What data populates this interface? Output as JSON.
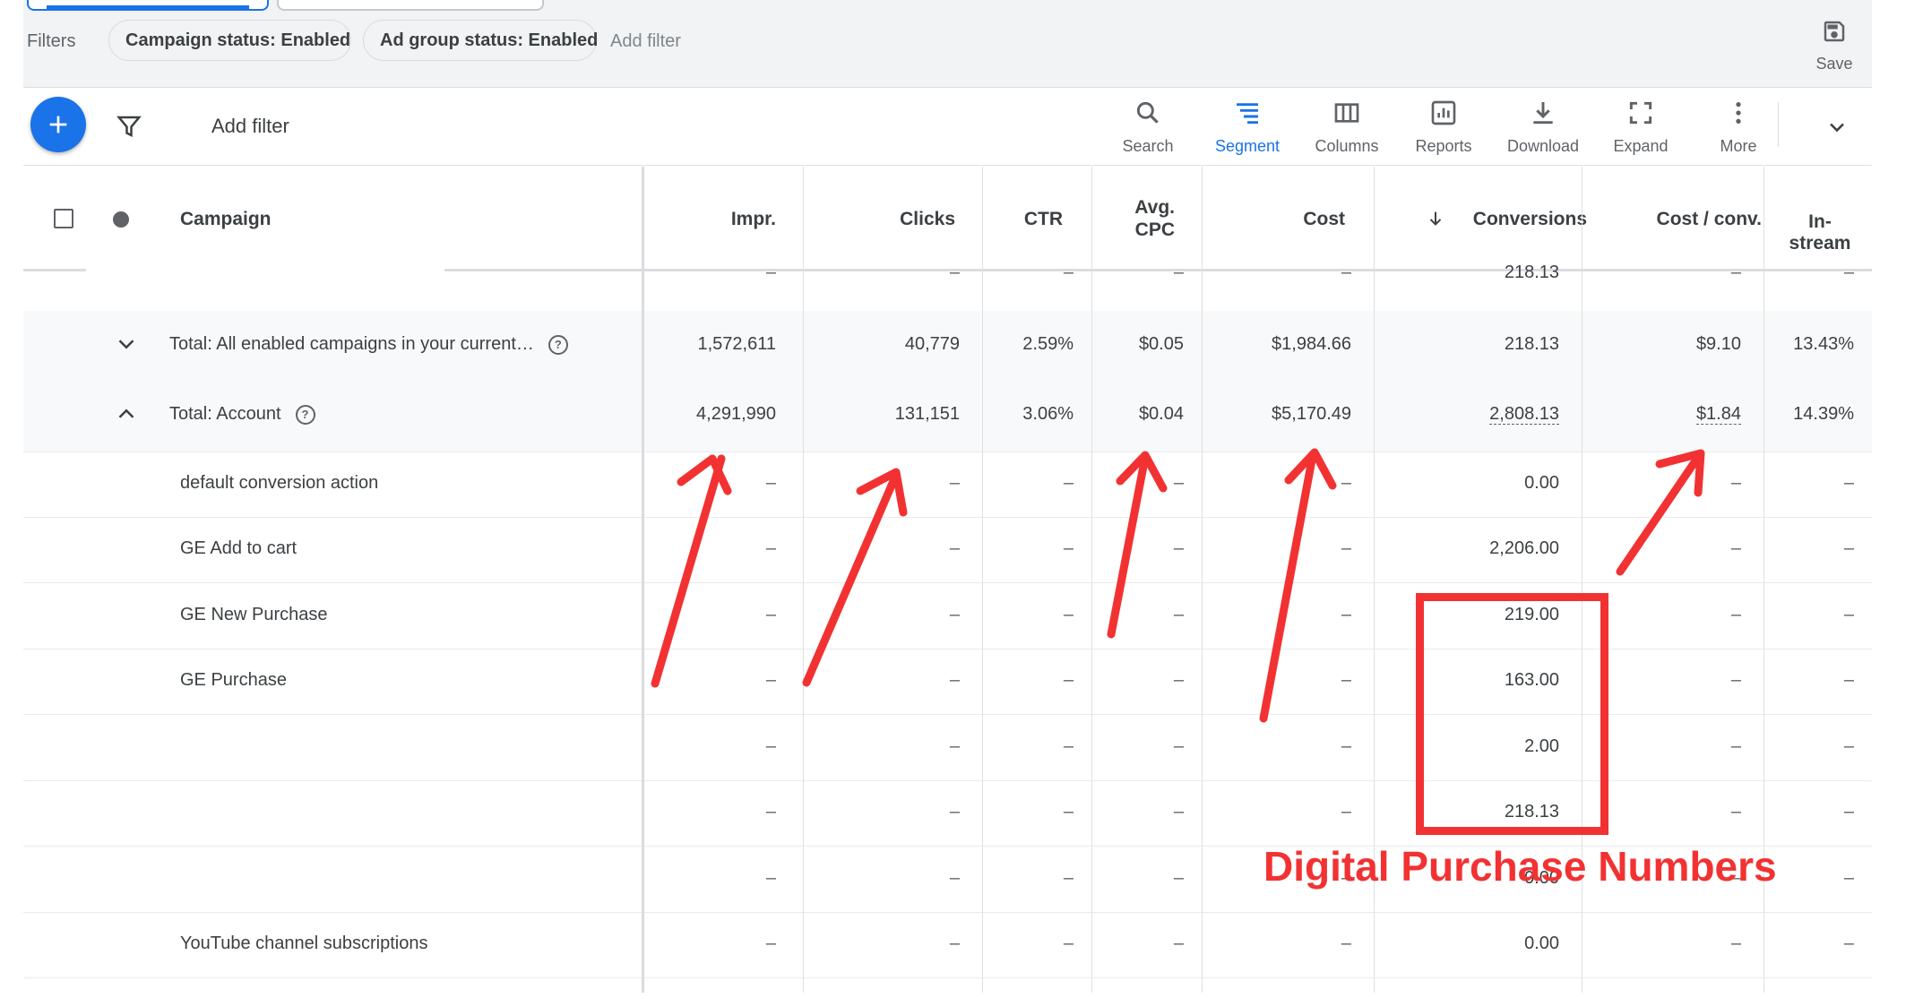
{
  "filter_bar": {
    "label": "Filters",
    "chips": [
      "Campaign status: Enabled",
      "Ad group status: Enabled"
    ],
    "add_filter": "Add filter",
    "save_label": "Save"
  },
  "toolbar": {
    "add_filter": "Add filter",
    "tools": [
      {
        "label": "Search",
        "icon": "search-icon"
      },
      {
        "label": "Segment",
        "icon": "segment-icon",
        "selected": true
      },
      {
        "label": "Columns",
        "icon": "columns-icon"
      },
      {
        "label": "Reports",
        "icon": "reports-icon"
      },
      {
        "label": "Download",
        "icon": "download-icon"
      },
      {
        "label": "Expand",
        "icon": "expand-icon"
      },
      {
        "label": "More",
        "icon": "more-icon"
      }
    ],
    "accent": "#1a73e8"
  },
  "table": {
    "headers": {
      "campaign": "Campaign",
      "impr": "Impr.",
      "clicks": "Clicks",
      "ctr": "CTR",
      "avg_cpc_1": "Avg.",
      "avg_cpc_2": "CPC",
      "cost": "Cost",
      "conversions": "Conversions",
      "cost_conv": "Cost / conv.",
      "instream_1": "In-",
      "instream_2": "stream"
    },
    "partial_row": {
      "impr": "–",
      "clicks": "–",
      "ctr": "–",
      "avg_cpc": "–",
      "cost": "–",
      "conversions": "218.13",
      "cost_conv": "–",
      "instream": "–"
    },
    "total_enabled": {
      "label": "Total: All enabled campaigns in your current…",
      "impr": "1,572,611",
      "clicks": "40,779",
      "ctr": "2.59%",
      "avg_cpc": "$0.05",
      "cost": "$1,984.66",
      "conversions": "218.13",
      "cost_conv": "$9.10",
      "instream": "13.43%"
    },
    "total_account": {
      "label": "Total: Account",
      "impr": "4,291,990",
      "clicks": "131,151",
      "ctr": "3.06%",
      "avg_cpc": "$0.04",
      "cost": "$5,170.49",
      "conversions": "2,808.13",
      "cost_conv": "$1.84",
      "instream": "14.39%"
    },
    "dash": "–",
    "conversion_rows": [
      {
        "name": "default conversion action",
        "conversions": "0.00"
      },
      {
        "name": "GE Add to cart",
        "conversions": "2,206.00"
      },
      {
        "name": "GE New Purchase",
        "conversions": "219.00"
      },
      {
        "name": "GE Purchase",
        "conversions": "163.00"
      },
      {
        "name": "",
        "conversions": "2.00"
      },
      {
        "name": "",
        "conversions": "218.13"
      },
      {
        "name": "",
        "conversions": "0.00"
      },
      {
        "name": "YouTube channel subscriptions",
        "conversions": "0.00"
      }
    ]
  },
  "annotation": {
    "text": "Digital Purchase Numbers",
    "color": "#f23232"
  }
}
